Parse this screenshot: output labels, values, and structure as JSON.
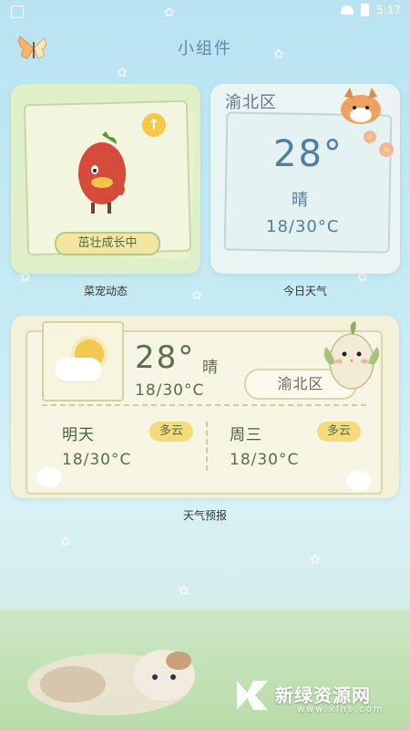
{
  "status_bar": {
    "time": "5:17"
  },
  "header": {
    "title": "小组件"
  },
  "pet_widget": {
    "status": "茁壮成长中",
    "caption": "菜宠动态"
  },
  "today_widget": {
    "location": "渝北区",
    "temperature": "28°",
    "condition": "晴",
    "range": "18/30°C",
    "caption": "今日天气"
  },
  "forecast_widget": {
    "temperature": "28°",
    "condition": "晴",
    "range": "18/30°C",
    "location": "渝北区",
    "days": [
      {
        "name": "明天",
        "condition": "多云",
        "range": "18/30°C"
      },
      {
        "name": "周三",
        "condition": "多云",
        "range": "18/30°C"
      }
    ],
    "caption": "天气预报"
  },
  "watermark": {
    "text": "新绿资源网",
    "url": "www.xlhs.com"
  },
  "icons": {
    "butterfly": "butterfly-icon",
    "wifi": "wifi-icon",
    "battery": "battery-icon",
    "gallery": "gallery-icon",
    "up_arrow": "up-arrow-icon",
    "sun": "sun-icon",
    "cloud": "cloud-icon"
  },
  "colors": {
    "background": "#c7ebf4",
    "accent_blue": "#4c7ea7",
    "forecast_text": "#5a6e49",
    "badge_yellow": "#f5dc7b"
  }
}
